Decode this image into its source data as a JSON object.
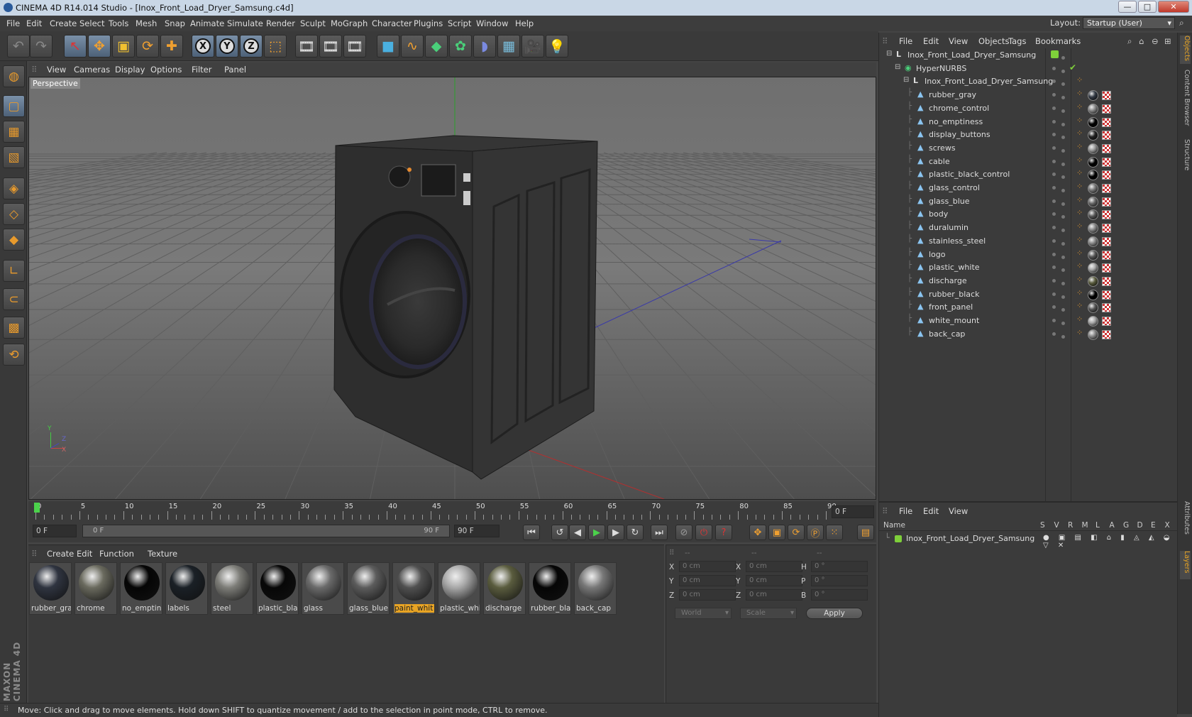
{
  "window": {
    "title": "CINEMA 4D R14.014 Studio - [Inox_Front_Load_Dryer_Samsung.c4d]",
    "minimize": "—",
    "maximize": "□",
    "close": "✕"
  },
  "menu": [
    "File",
    "Edit",
    "Create",
    "Select",
    "Tools",
    "Mesh",
    "Snap",
    "Animate",
    "Simulate",
    "Render",
    "Sculpt",
    "MoGraph",
    "Character",
    "Plugins",
    "Script",
    "Window",
    "Help"
  ],
  "layout": {
    "label": "Layout:",
    "value": "Startup (User)"
  },
  "toolbar": {
    "undo": "↶",
    "redo": "↷",
    "select": "↖",
    "move": "✥",
    "scale": "▣",
    "rotate": "⟳",
    "add": "✚",
    "x": "X",
    "y": "Y",
    "z": "Z",
    "coord": "⬚",
    "render_view": "🎞",
    "render_pic": "🎞",
    "render_settings": "🎞",
    "cube": "■",
    "spline": "∿",
    "nurbs": "◆",
    "array": "✿",
    "deformer": "◗",
    "floor": "▦",
    "camera": "🎥",
    "light": "💡"
  },
  "viewport": {
    "menu": [
      "View",
      "Cameras",
      "Display",
      "Options",
      "Filter",
      "Panel"
    ],
    "label": "Perspective",
    "axis_x": "X",
    "axis_y": "Y",
    "axis_z": "Z"
  },
  "timeline": {
    "ticks": [
      "0",
      "5",
      "10",
      "15",
      "20",
      "25",
      "30",
      "35",
      "40",
      "45",
      "50",
      "55",
      "60",
      "65",
      "70",
      "75",
      "80",
      "85",
      "90"
    ],
    "current": "0 F"
  },
  "transport": {
    "start": "0 F",
    "range_start": "0 F",
    "range_end": "90 F",
    "end": "90 F"
  },
  "materials": {
    "menu": [
      "Create",
      "Edit",
      "Function",
      "Texture"
    ],
    "items": [
      {
        "label": "rubber_gra",
        "color": "#2f3440"
      },
      {
        "label": "chrome",
        "color": "#6a6a5e"
      },
      {
        "label": "no_emptin",
        "color": "#050505"
      },
      {
        "label": "labels",
        "color": "#1a2026"
      },
      {
        "label": "steel",
        "color": "#7d7d78"
      },
      {
        "label": "plastic_bla",
        "color": "#070707"
      },
      {
        "label": "glass",
        "color": "#6a6a6a"
      },
      {
        "label": "glass_blue",
        "color": "#5c5c5c"
      },
      {
        "label": "paint_whit",
        "color": "#505050"
      },
      {
        "label": "plastic_whi",
        "color": "#a8a8a8"
      },
      {
        "label": "discharge",
        "color": "#5a5c3e"
      },
      {
        "label": "rubber_bla",
        "color": "#050505"
      },
      {
        "label": "back_cap",
        "color": "#777"
      }
    ],
    "selected": "paint_whit"
  },
  "coordinates": {
    "headers": [
      "--",
      "--",
      "--"
    ],
    "rows": [
      {
        "a": "X",
        "av": "0 cm",
        "b": "X",
        "bv": "0 cm",
        "c": "H",
        "cv": "0 °"
      },
      {
        "a": "Y",
        "av": "0 cm",
        "b": "Y",
        "bv": "0 cm",
        "c": "P",
        "cv": "0 °"
      },
      {
        "a": "Z",
        "av": "0 cm",
        "b": "Z",
        "bv": "0 cm",
        "c": "B",
        "cv": "0 °"
      }
    ],
    "mode1": "World",
    "mode2": "Scale",
    "apply": "Apply"
  },
  "status": "Move: Click and drag to move elements. Hold down SHIFT to quantize movement / add to the selection in point mode, CTRL to remove.",
  "objects": {
    "menu": [
      "File",
      "Edit",
      "View",
      "Objects",
      "Tags",
      "Bookmarks"
    ],
    "root": "Inox_Front_Load_Dryer_Samsung",
    "nurbs": "HyperNURBS",
    "group": "Inox_Front_Load_Dryer_Samsung",
    "children": [
      {
        "name": "rubber_gray",
        "mat": "#333a44"
      },
      {
        "name": "chrome_control",
        "mat": "#888"
      },
      {
        "name": "no_emptiness",
        "mat": "#000"
      },
      {
        "name": "display_buttons",
        "mat": "#222"
      },
      {
        "name": "screws",
        "mat": "#999"
      },
      {
        "name": "cable",
        "mat": "#000"
      },
      {
        "name": "plastic_black_control",
        "mat": "#000"
      },
      {
        "name": "glass_control",
        "mat": "#777"
      },
      {
        "name": "glass_blue",
        "mat": "#666"
      },
      {
        "name": "body",
        "mat": "#555"
      },
      {
        "name": "duralumin",
        "mat": "#888"
      },
      {
        "name": "stainless_steel",
        "mat": "#888"
      },
      {
        "name": "logo",
        "mat": "#555"
      },
      {
        "name": "plastic_white",
        "mat": "#aaa"
      },
      {
        "name": "discharge",
        "mat": "#5a5c3e"
      },
      {
        "name": "rubber_black",
        "mat": "#000"
      },
      {
        "name": "front_panel",
        "mat": "#555"
      },
      {
        "name": "white_mount",
        "mat": "#aaa"
      },
      {
        "name": "back_cap",
        "mat": "#888"
      }
    ]
  },
  "sidetabs": [
    "Objects",
    "Content Browser",
    "Structure",
    "Attributes",
    "Layers"
  ],
  "layers": {
    "menu": [
      "File",
      "Edit",
      "View"
    ],
    "cols": [
      "Name",
      "S",
      "V",
      "R",
      "M",
      "L",
      "A",
      "G",
      "D",
      "E",
      "X"
    ],
    "row": "Inox_Front_Load_Dryer_Samsung"
  },
  "brand": "MAXON CINEMA 4D"
}
